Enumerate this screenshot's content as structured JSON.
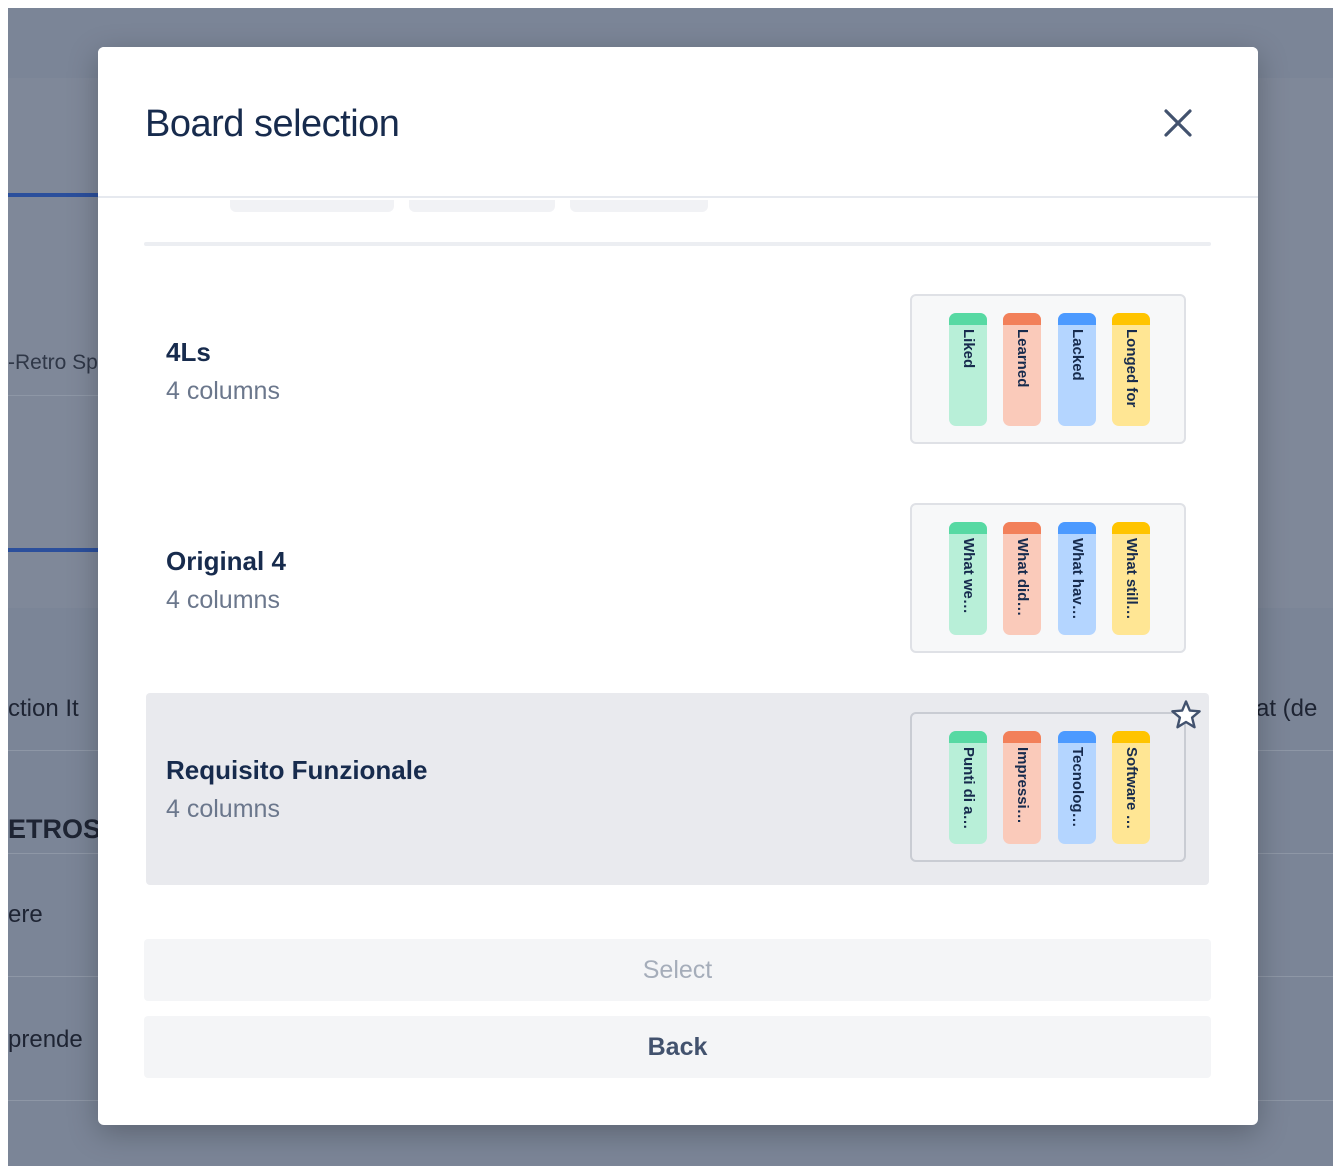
{
  "background": {
    "fragments": [
      "-Retro Sp",
      "ction It",
      "at (de",
      "ETROSP",
      "ere",
      "prende"
    ]
  },
  "modal": {
    "title": "Board selection",
    "close_icon": "close-icon",
    "boards": [
      {
        "name": "4Ls",
        "subtitle": "4 columns",
        "selected": false,
        "columns": [
          {
            "label": "Liked",
            "color": "#57d9a3"
          },
          {
            "label": "Learned",
            "color": "#f2805a"
          },
          {
            "label": "Lacked",
            "color": "#4c9aff"
          },
          {
            "label": "Longed for",
            "color": "#ffc400"
          }
        ]
      },
      {
        "name": "Original 4",
        "subtitle": "4 columns",
        "selected": false,
        "columns": [
          {
            "label": "What we…",
            "color": "#57d9a3"
          },
          {
            "label": "What did…",
            "color": "#f2805a"
          },
          {
            "label": "What hav…",
            "color": "#4c9aff"
          },
          {
            "label": "What still…",
            "color": "#ffc400"
          }
        ]
      },
      {
        "name": "Requisito Funzionale",
        "subtitle": "4 columns",
        "selected": true,
        "star_icon": "star-outline-icon",
        "columns": [
          {
            "label": "Punti di a…",
            "color": "#57d9a3"
          },
          {
            "label": "Impressi…",
            "color": "#f2805a"
          },
          {
            "label": "Tecnolog…",
            "color": "#4c9aff"
          },
          {
            "label": "Software …",
            "color": "#ffc400"
          }
        ]
      }
    ],
    "buttons": {
      "select_label": "Select",
      "back_label": "Back"
    }
  }
}
